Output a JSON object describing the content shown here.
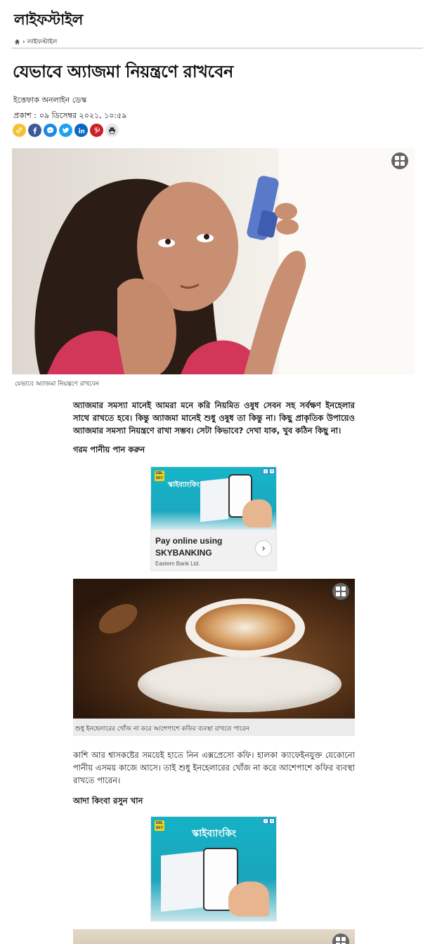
{
  "section": {
    "title": "লাইফস্টাইল"
  },
  "breadcrumb": {
    "home_icon": "home-icon",
    "separator": "›",
    "current": "লাইফস্টাইল"
  },
  "article": {
    "headline": "যেভাবে অ্যাজমা নিয়ন্ত্রণে রাখবেন",
    "author": "ইত্তেফাক অনলাইন ডেস্ক",
    "published_label": "প্রকাশ :",
    "published_date": "০৯ ডিসেম্বর ২০২১, ১০:৫৯",
    "hero_caption": "যেভাবে অ্যাজমা নিয়ন্ত্রণে রাখবেন",
    "lead": "অ্যাজমার সমস্যা মানেই আমরা মনে করি নিয়মিত ওষুধ সেবন সহ সর্বক্ষণ ইনহেলার সাথে রাখতে হবে। কিন্তু অ্যাজমা মানেই শুধু ওষুধ তা কিন্তু না। কিছু প্রাকৃতিক উপায়েও অ্যাজমার সমস্যা নিয়ন্ত্রণে রাখা সম্ভব। সেটা কিভাবে? দেখা যাক, খুব কঠিন কিছু না।",
    "subhead_1": "গরম পানীয় পান করুন",
    "coffee_caption": "শুধু ইনহেলারের খোঁজ না করে আশেপাশে কফির ব্যবস্থা রাখতে পারেন",
    "paragraph_1": "কাশি আর শ্বাসকষ্টের সময়েই হাতে নিন এক্সপ্রেসো কফি। হালকা ক্যাফেইনযুক্ত যেকোনো পানীয় এসময় কাজে আসে। তাই শুধু ইনহেলারের খোঁজ না করে আশেপাশে কফির ব্যবস্থা রাখতে পারেন।",
    "subhead_2": "আদা কিংবা রসুন খান"
  },
  "share": {
    "icons": [
      "link-icon",
      "facebook-icon",
      "messenger-icon",
      "twitter-icon",
      "linkedin-icon",
      "pinterest-icon",
      "print-icon"
    ],
    "colors": {
      "link": "#f2c230",
      "facebook": "#3b5998",
      "messenger": "#1e88e5",
      "twitter": "#1da1f2",
      "linkedin": "#0a66c2",
      "pinterest": "#cb2027",
      "print": "#e6e6e6"
    }
  },
  "ad_1": {
    "brand_badge": "EBL SKY",
    "tagline": "স্কাইব্যাংকিং",
    "headline": "Pay online using SKYBANKING",
    "advertiser": "Eastern Bank Ltd."
  },
  "ad_2": {
    "brand_badge": "EBL SKY",
    "tagline": "স্কাইব্যাংকিং"
  },
  "colors": {
    "accent": "#111111",
    "rule": "#bbbbbb",
    "gallery_button": "#666666"
  }
}
